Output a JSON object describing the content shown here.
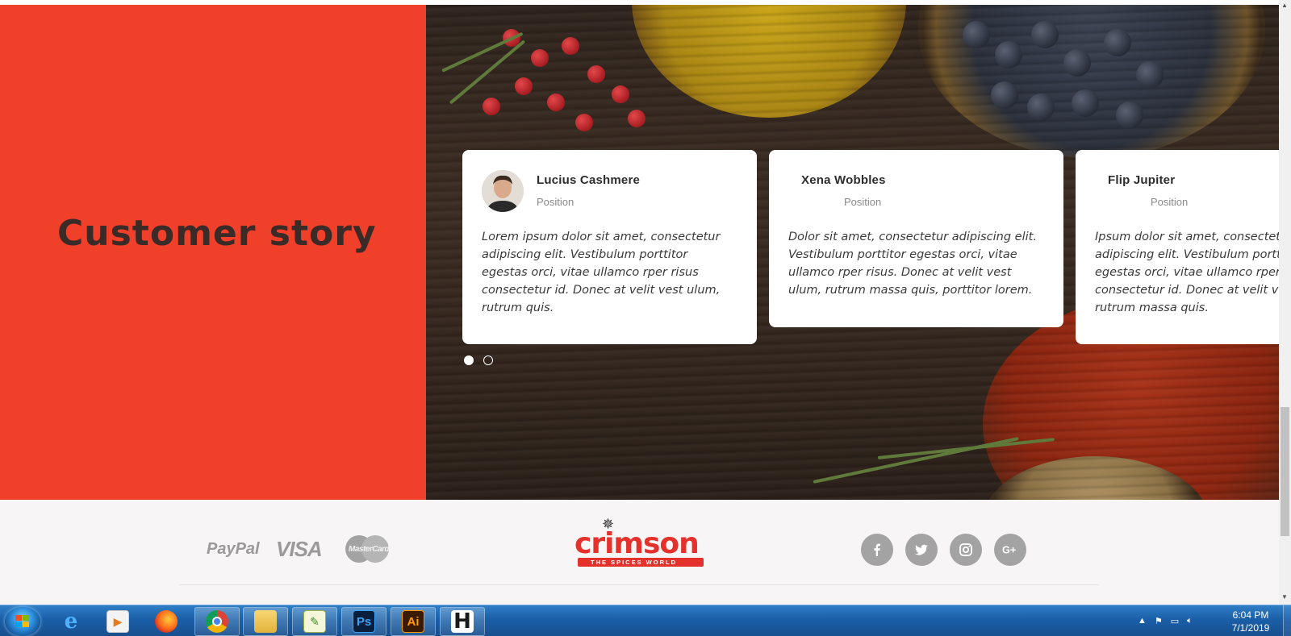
{
  "section": {
    "heading": "Customer story"
  },
  "testimonials": [
    {
      "name": "Lucius Cashmere",
      "position": "Position",
      "quote": "Lorem ipsum dolor sit amet, consectetur adipiscing elit. Vestibulum porttitor egestas orci, vitae ullamco rper risus consectetur id. Donec at velit vest ulum, rutrum quis."
    },
    {
      "name": "Xena Wobbles",
      "position": "Position",
      "quote": "Dolor sit amet, consectetur adipiscing elit. Vestibulum porttitor egestas orci, vitae ullamco rper risus. Donec at velit vest ulum, rutrum massa quis, porttitor lorem."
    },
    {
      "name": "Flip Jupiter",
      "position": "Position",
      "quote": "Ipsum dolor sit amet, consectetur adipiscing elit. Vestibulum porttitor egestas orci, vitae ullamco rper risus consectetur id. Donec at velit vest ulum, rutrum massa quis."
    }
  ],
  "carousel": {
    "page_count": 2,
    "active_page": 1
  },
  "footer": {
    "payment_methods": {
      "paypal": "PayPal",
      "visa": "VISA",
      "mastercard": "MasterCard"
    },
    "logo": {
      "word": "crimson",
      "tagline": "THE SPICES WORLD"
    },
    "social_icons": [
      "facebook-icon",
      "twitter-icon",
      "instagram-icon",
      "google-plus-icon"
    ]
  },
  "taskbar": {
    "apps": [
      "internet-explorer-icon",
      "media-player-icon",
      "firefox-icon",
      "chrome-icon",
      "file-explorer-icon",
      "notepad-icon",
      "photoshop-icon",
      "illustrator-icon",
      "h-app-icon"
    ],
    "photoshop_label": "Ps",
    "illustrator_label": "Ai",
    "h_label": "H",
    "clock_time": "6:04 PM",
    "clock_date": "7/1/2019"
  },
  "colors": {
    "accent_red": "#f0402a",
    "heading": "#3a2a28",
    "footer_icons": "#a3a3a3",
    "logo_red": "#e5312b"
  }
}
